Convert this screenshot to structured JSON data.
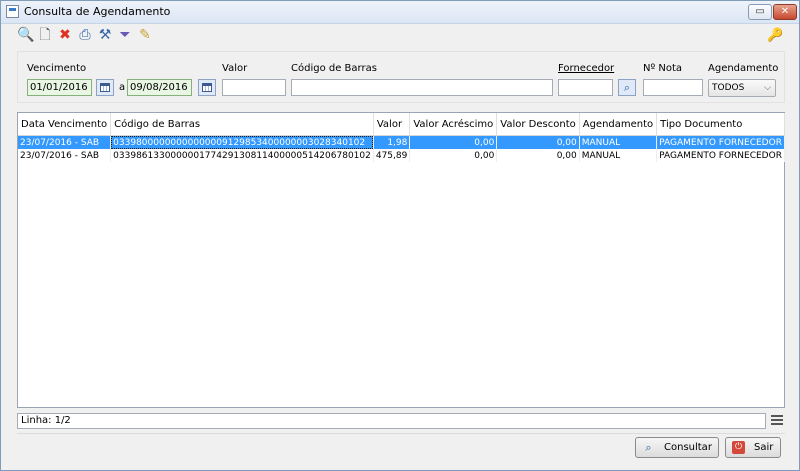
{
  "window": {
    "title": "Consulta de Agendamento",
    "restore_glyph": "▭",
    "close_glyph": "✕"
  },
  "toolbar": {
    "icons": [
      {
        "name": "search-icon",
        "glyph": "🔍",
        "color": "#2f5fa8"
      },
      {
        "name": "new-document-icon",
        "glyph": "🗋",
        "color": "#555555"
      },
      {
        "name": "delete-icon",
        "glyph": "✖",
        "color": "#e03020"
      },
      {
        "name": "print-icon",
        "glyph": "⎙",
        "color": "#3a66a8"
      },
      {
        "name": "tools-icon",
        "glyph": "⚒",
        "color": "#3a66a8"
      },
      {
        "name": "filter-icon",
        "glyph": "⏷",
        "color": "#6a5ab8"
      },
      {
        "name": "edit-icon",
        "glyph": "✎",
        "color": "#c9a23a"
      }
    ],
    "key_glyph": "🔑"
  },
  "filters": {
    "vencimento_label": "Vencimento",
    "date_from": "01/01/2016",
    "separator": "a",
    "date_to": "09/08/2016",
    "valor_label": "Valor",
    "valor_value": "",
    "codigo_label": "Código de Barras",
    "codigo_value": "",
    "fornecedor_label": "Fornecedor",
    "fornecedor_value": "",
    "nota_label": "Nº Nota",
    "nota_value": "",
    "agendamento_label": "Agendamento",
    "agendamento_value": "TODOS"
  },
  "grid": {
    "columns": [
      "Data Vencimento",
      "Código de Barras",
      "Valor",
      "Valor Acréscimo",
      "Valor Desconto",
      "Agendamento",
      "Tipo Documento"
    ],
    "rows": [
      [
        "23/07/2016 - SAB",
        "03398000000000000009129853400000003028340102",
        "1,98",
        "0,00",
        "0,00",
        "MANUAL",
        "PAGAMENTO FORNECEDOR"
      ],
      [
        "23/07/2016 - SAB",
        "03398613300000017742913081140000051420678010​2",
        "475,89",
        "0,00",
        "0,00",
        "MANUAL",
        "PAGAMENTO FORNECEDOR"
      ]
    ],
    "selected_row": 0
  },
  "status": {
    "linha": "Linha: 1/2"
  },
  "buttons": {
    "consultar": "Consultar",
    "sair": "Sair"
  },
  "colors": {
    "selection": "#3399ff",
    "date_field": "#e8f6e3"
  }
}
